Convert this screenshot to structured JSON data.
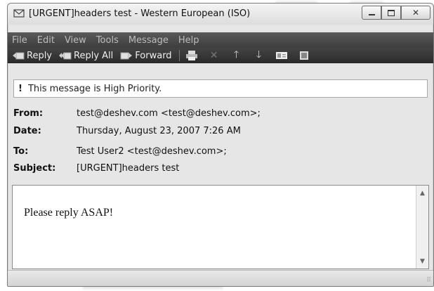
{
  "window": {
    "title": "[URGENT]headers test - Western European (ISO)",
    "controls": {
      "minimize": "minimize",
      "maximize": "maximize",
      "close": "close"
    }
  },
  "menu": {
    "items": [
      "File",
      "Edit",
      "View",
      "Tools",
      "Message",
      "Help"
    ]
  },
  "toolbar": {
    "reply_label": "Reply",
    "reply_all_label": "Reply All",
    "forward_label": "Forward",
    "icons": [
      "printer-icon",
      "delete-icon",
      "previous-icon",
      "next-icon",
      "addresses-icon",
      "messages-icon"
    ]
  },
  "priority_bar": {
    "symbol": "!",
    "text": "This message is High Priority."
  },
  "headers": {
    "from_label": "From:",
    "from_value": "test@deshev.com <test@deshev.com>;",
    "date_label": "Date:",
    "date_value": "Thursday, August 23, 2007 7:26 AM",
    "to_label": "To:",
    "to_value": "Test User2 <test@deshev.com>;",
    "subject_label": "Subject:",
    "subject_value": "[URGENT]headers test"
  },
  "message": {
    "body": "Please reply ASAP!"
  },
  "colors": {
    "menubar": "#4a4a4a",
    "toolbar": "#333333",
    "window_bg": "#e6e6e6"
  }
}
